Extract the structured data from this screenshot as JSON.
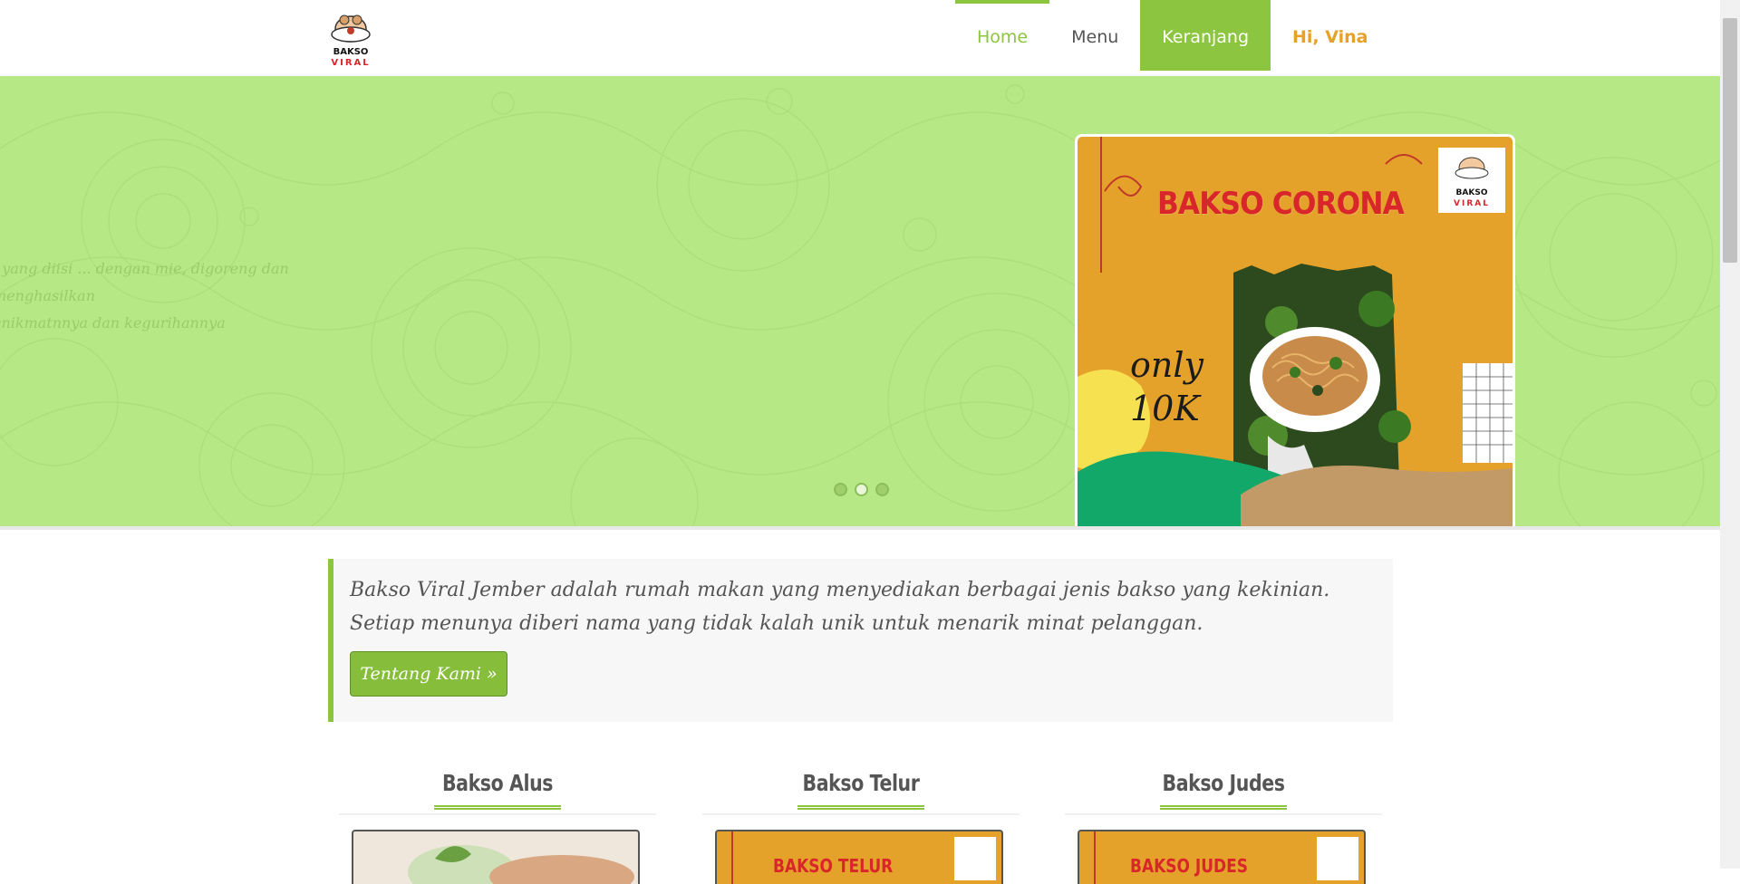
{
  "brand": {
    "logo_line1": "BAKSO",
    "logo_line2": "VIRAL"
  },
  "nav": {
    "home": "Home",
    "menu": "Menu",
    "cart": "Keranjang",
    "user": "Hi, Vina"
  },
  "hero": {
    "faded_caption_line1": "i yang diisi ... dengan mie, digoreng dan menghasilkan",
    "faded_caption_line2": "enikmatnnya dan kegurihannya",
    "slide_count": 3,
    "active_slide": 2,
    "promo": {
      "title": "BAKSO CORONA",
      "price_line1": "only",
      "price_line2": "10K"
    }
  },
  "intro": {
    "text": "Bakso Viral Jember adalah rumah makan yang menyediakan berbagai jenis bakso yang kekinian. Setiap menunya diberi nama yang tidak kalah unik untuk menarik minat pelanggan.",
    "button": "Tentang Kami »"
  },
  "products": [
    {
      "name": "Bakso Alus"
    },
    {
      "name": "Bakso Telur",
      "thumb_text": "BAKSO TELUR"
    },
    {
      "name": "Bakso Judes",
      "thumb_text": "BAKSO JUDES"
    }
  ],
  "colors": {
    "accent": "#8cc540",
    "user": "#e8a128",
    "hero_bg": "#b6e985",
    "promo_bg": "#e5a22b",
    "promo_title": "#d9262b"
  }
}
